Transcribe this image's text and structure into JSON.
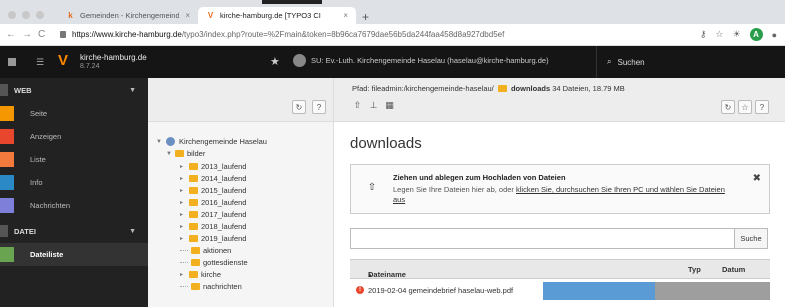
{
  "browser": {
    "tabs": [
      {
        "icon": "k",
        "title": "Gemeinden - Kirchengemeinde",
        "close": "×"
      },
      {
        "icon": "V",
        "title": "kirche-hamburg.de [TYPO3 CI",
        "close": "×"
      }
    ],
    "new_tab": "+",
    "url_host": "https://www.kirche-hamburg.de",
    "url_path": "/typo3/index.php?route=%2Fmain&token=8b96ca7679dae56b5da244faa458d8a927dbd5ef",
    "avatar_letter": "A"
  },
  "topbar": {
    "site_name": "kirche-hamburg.de",
    "version": "8.7.24",
    "user": "SU: Ev.-Luth. Kirchengemeinde Haselau (haselau@kirche-hamburg.de)",
    "search_label": "Suchen"
  },
  "modules": {
    "web_label": "WEB",
    "web_items": [
      {
        "label": "Seite",
        "color": "#f49700"
      },
      {
        "label": "Anzeigen",
        "color": "#e8462d"
      },
      {
        "label": "Liste",
        "color": "#f27a3c"
      },
      {
        "label": "Info",
        "color": "#2b8ac6"
      },
      {
        "label": "Nachrichten",
        "color": "#7d7fd8"
      }
    ],
    "datei_label": "DATEI",
    "datei_items": [
      {
        "label": "Dateiliste",
        "color": "#69a550",
        "active": true
      }
    ]
  },
  "tree": {
    "root": "Kirchengemeinde Haselau",
    "bilder": "bilder",
    "folders": [
      "2013_laufend",
      "2014_laufend",
      "2015_laufend",
      "2016_laufend",
      "2017_laufend",
      "2018_laufend",
      "2019_laufend",
      "aktionen",
      "gottesdienste",
      "kirche",
      "nachrichten"
    ]
  },
  "content": {
    "path_label": "Pfad:",
    "path_value": "fileadmin:/kirchengemeinde-haselau/",
    "folder_name": "downloads",
    "file_info": "34 Dateien, 18.79 MB",
    "title": "downloads",
    "drop_title": "Ziehen und ablegen zum Hochladen von Dateien",
    "drop_text_pre": "Legen Sie Ihre Dateien hier ab, oder ",
    "drop_link": "klicken Sie, durchsuchen Sie Ihren PC und wählen Sie Dateien aus",
    "search_button": "Suche",
    "columns": {
      "name": "Dateiname",
      "type": "Typ",
      "date": "Datum"
    },
    "files": [
      {
        "name": "2019-02-04 gemeindebrief haselau-web.pdf"
      }
    ]
  }
}
